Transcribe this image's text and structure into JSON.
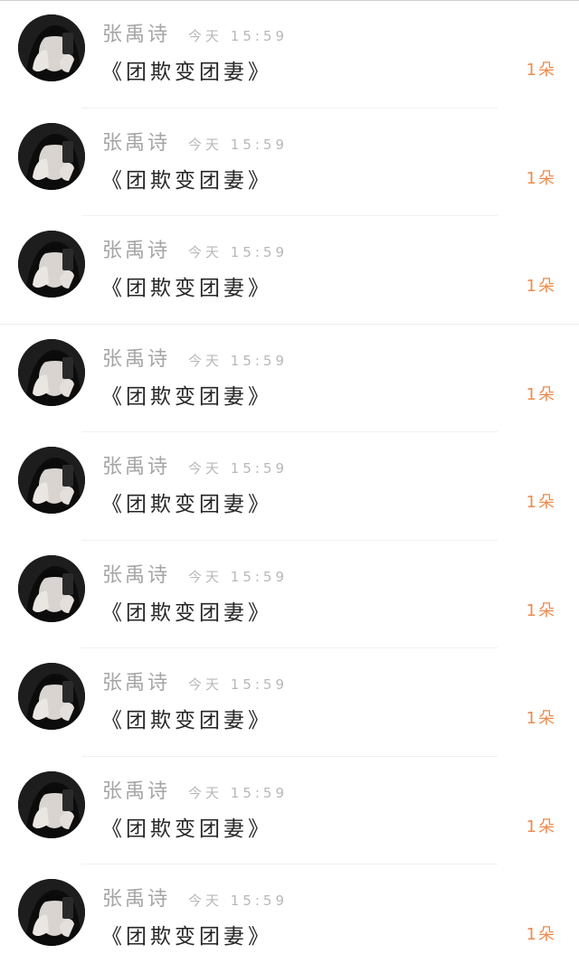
{
  "colors": {
    "background": "#ffffff",
    "name_text": "#a5a5a5",
    "time_text": "#b8b8b8",
    "content_text": "#262626",
    "count_accent": "#f08a4b"
  },
  "messages": [
    {
      "name": "张禹诗",
      "time": "今天 15:59",
      "content": "《团欺变团妻》",
      "count": "1朵",
      "avatar_icon": "user-avatar-photo"
    },
    {
      "name": "张禹诗",
      "time": "今天 15:59",
      "content": "《团欺变团妻》",
      "count": "1朵",
      "avatar_icon": "user-avatar-photo"
    },
    {
      "name": "张禹诗",
      "time": "今天 15:59",
      "content": "《团欺变团妻》",
      "count": "1朵",
      "avatar_icon": "user-avatar-photo"
    },
    {
      "name": "张禹诗",
      "time": "今天 15:59",
      "content": "《团欺变团妻》",
      "count": "1朵",
      "avatar_icon": "user-avatar-photo"
    },
    {
      "name": "张禹诗",
      "time": "今天 15:59",
      "content": "《团欺变团妻》",
      "count": "1朵",
      "avatar_icon": "user-avatar-photo"
    },
    {
      "name": "张禹诗",
      "time": "今天 15:59",
      "content": "《团欺变团妻》",
      "count": "1朵",
      "avatar_icon": "user-avatar-photo"
    },
    {
      "name": "张禹诗",
      "time": "今天 15:59",
      "content": "《团欺变团妻》",
      "count": "1朵",
      "avatar_icon": "user-avatar-photo"
    },
    {
      "name": "张禹诗",
      "time": "今天 15:59",
      "content": "《团欺变团妻》",
      "count": "1朵",
      "avatar_icon": "user-avatar-photo"
    },
    {
      "name": "张禹诗",
      "time": "今天 15:59",
      "content": "《团欺变团妻》",
      "count": "1朵",
      "avatar_icon": "user-avatar-photo"
    }
  ]
}
